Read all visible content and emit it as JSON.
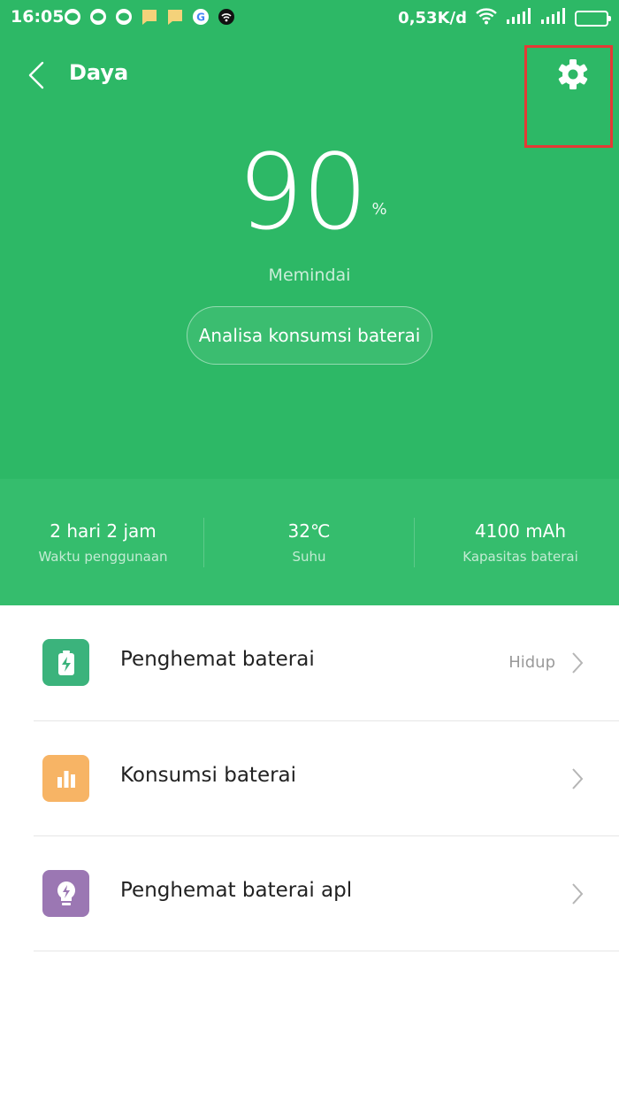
{
  "status_bar": {
    "time": "16:05",
    "net_speed": "0,53K/d",
    "notifications": [
      "line-icon",
      "line-icon",
      "line-icon",
      "message-icon",
      "message-icon",
      "google-icon",
      "wifi-key-icon"
    ]
  },
  "header": {
    "title": "Daya",
    "back_icon": "chevron-left-icon",
    "settings_icon": "gear-icon"
  },
  "battery": {
    "percent": "90",
    "unit": "%",
    "status": "Memindai",
    "analyze_label": "Analisa konsumsi baterai"
  },
  "stats": [
    {
      "value": "2 hari 2 jam",
      "label": "Waktu penggunaan"
    },
    {
      "value": "32℃",
      "label": "Suhu"
    },
    {
      "value": "4100 mAh",
      "label": "Kapasitas baterai"
    }
  ],
  "menu": [
    {
      "label": "Penghemat baterai",
      "value": "Hidup",
      "icon": "battery-charge-icon",
      "color": "#3bb37c"
    },
    {
      "label": "Konsumsi baterai",
      "value": "",
      "icon": "bar-chart-icon",
      "color": "#f7b465"
    },
    {
      "label": "Penghemat baterai apl",
      "value": "",
      "icon": "bulb-bolt-icon",
      "color": "#9b77b3"
    }
  ],
  "colors": {
    "primary": "#2db866",
    "stats_bg": "#35bd6d",
    "highlight": "#e53935"
  }
}
